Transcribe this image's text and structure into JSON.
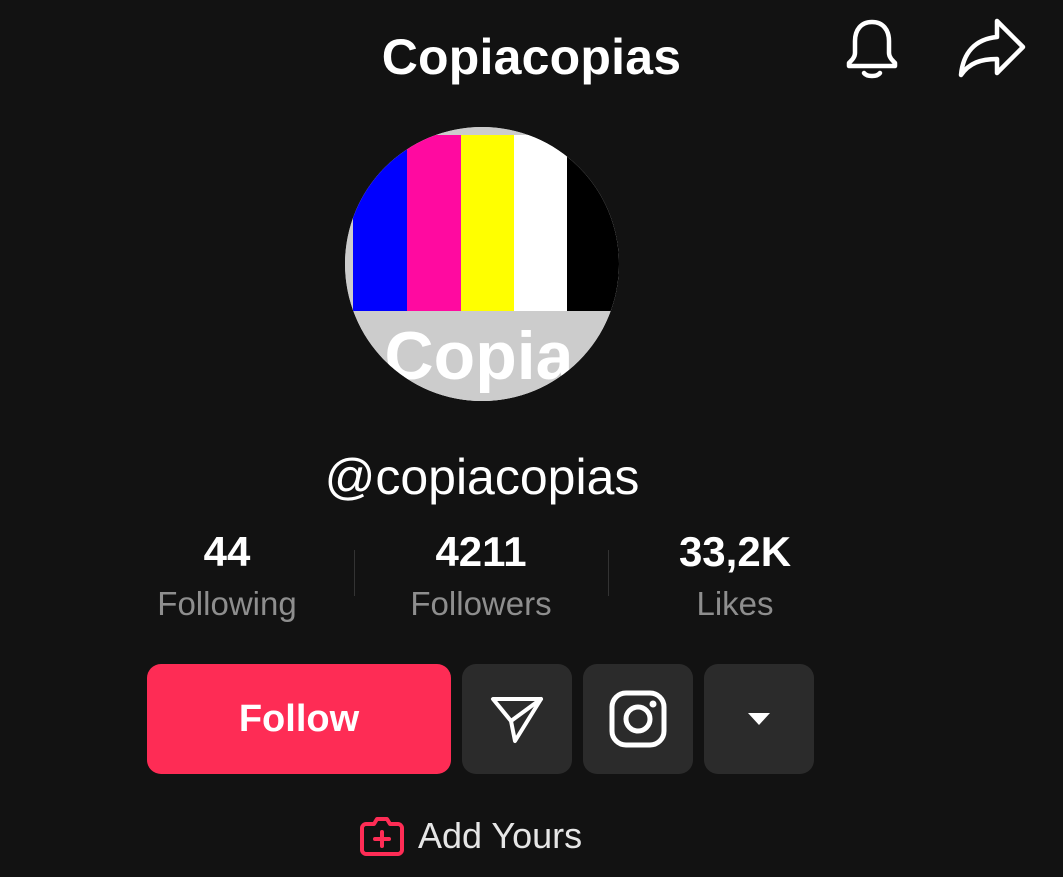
{
  "header": {
    "title": "Copiacopias",
    "notification_icon": "bell-icon",
    "share_icon": "share-arrow-icon"
  },
  "profile": {
    "avatar_text": "Copia",
    "avatar_colors": [
      "#0000ff",
      "#ff0aa0",
      "#ffff00",
      "#ffffff",
      "#000000"
    ],
    "handle": "@copiacopias"
  },
  "stats": [
    {
      "value": "44",
      "label": "Following"
    },
    {
      "value": "4211",
      "label": "Followers"
    },
    {
      "value": "33,2K",
      "label": "Likes"
    }
  ],
  "actions": {
    "follow_label": "Follow",
    "message_icon": "send-icon",
    "instagram_icon": "instagram-icon",
    "more_icon": "caret-down-icon",
    "add_yours_label": "Add Yours",
    "add_yours_icon": "add-yours-icon"
  },
  "colors": {
    "background": "#121212",
    "accent": "#fe2c55",
    "secondary_button": "#2b2b2b",
    "muted_text": "#8e8e8e"
  }
}
